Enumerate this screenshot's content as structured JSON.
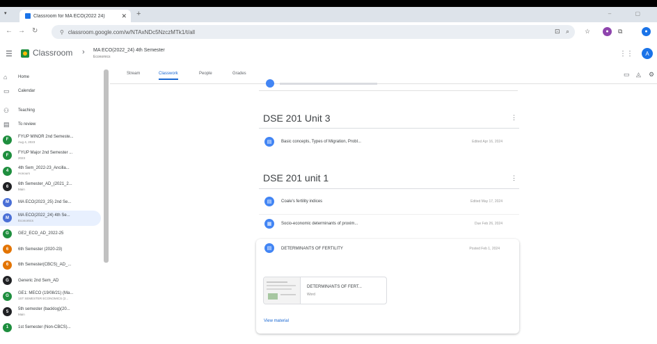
{
  "browser": {
    "tab_title": "Classroom for MA ECO(2022 24)",
    "url": "classroom.google.com/w/NTAxNDc5NzczMTk1/t/all"
  },
  "header": {
    "app_name": "Classroom",
    "course_name": "MA ECO(2022_24) 4th Semester",
    "course_subtitle": "Economics",
    "avatar_letter": "A"
  },
  "sidebar": {
    "home": "Home",
    "calendar": "Calendar",
    "teaching": "Teaching",
    "to_review": "To review",
    "classes": [
      {
        "title": "FYUP MINOR 2nd Semeste...",
        "sub": "Aug 4, 2023",
        "letter": "F",
        "color": "#1e8e3e"
      },
      {
        "title": "FYUP Major 2nd Semester ...",
        "sub": "2023",
        "letter": "F",
        "color": "#1e8e3e"
      },
      {
        "title": "4th Sem_2022-23_Ancilla...",
        "sub": "Honours",
        "letter": "4",
        "color": "#1e8e3e"
      },
      {
        "title": "6th Semester_AD_(2021_2...",
        "sub": "Main",
        "letter": "6",
        "color": "#202124"
      },
      {
        "title": "MA ECO(2023_25) 2nd Se...",
        "sub": "",
        "letter": "M",
        "color": "#4a6fd6"
      },
      {
        "title": "MA ECO(2022_24) 4th Se...",
        "sub": "Economics",
        "letter": "M",
        "color": "#4a6fd6"
      },
      {
        "title": "GE2_ECO_AD_2022-25",
        "sub": "",
        "letter": "G",
        "color": "#1e8e3e"
      },
      {
        "title": "6th Semester (2020-23)",
        "sub": "",
        "letter": "6",
        "color": "#e37400"
      },
      {
        "title": "6th Semester(CBCS)_AD_...",
        "sub": "",
        "letter": "6",
        "color": "#e37400"
      },
      {
        "title": "Generic 2nd Sem_AD",
        "sub": "",
        "letter": "G",
        "color": "#202124"
      },
      {
        "title": "GE1: MECO (19/08/21) (Ma...",
        "sub": "1ST SEMESTER ECONOMICS (2...",
        "letter": "G",
        "color": "#1e8e3e"
      },
      {
        "title": "5th semester (backlog)(20...",
        "sub": "Main",
        "letter": "5",
        "color": "#202124"
      },
      {
        "title": "1st Semester (Non-CBCS)...",
        "sub": "",
        "letter": "1",
        "color": "#1e8e3e"
      }
    ]
  },
  "main": {
    "tabs": [
      "Stream",
      "Classwork",
      "People",
      "Grades"
    ],
    "topics": [
      {
        "title": "DSE 201 Unit 3",
        "items": [
          {
            "title": "Basic concepts, Types of Migration, Probl...",
            "date": "Edited Apr 16, 2024"
          }
        ]
      },
      {
        "title": "DSE 201 unit 1",
        "items": [
          {
            "title": "Coale's fertility indices",
            "date": "Edited May 17, 2024"
          },
          {
            "title": "Socio-economic determinants of proxim...",
            "date": "Due Feb 26, 2024"
          },
          {
            "title": "DETERMINANTS OF FERTILITY",
            "date": "Posted Feb 1, 2024"
          }
        ]
      }
    ],
    "attachment": {
      "name": "DETERMINANTS OF FERT...",
      "type": "Word"
    },
    "view_material": "View material"
  }
}
